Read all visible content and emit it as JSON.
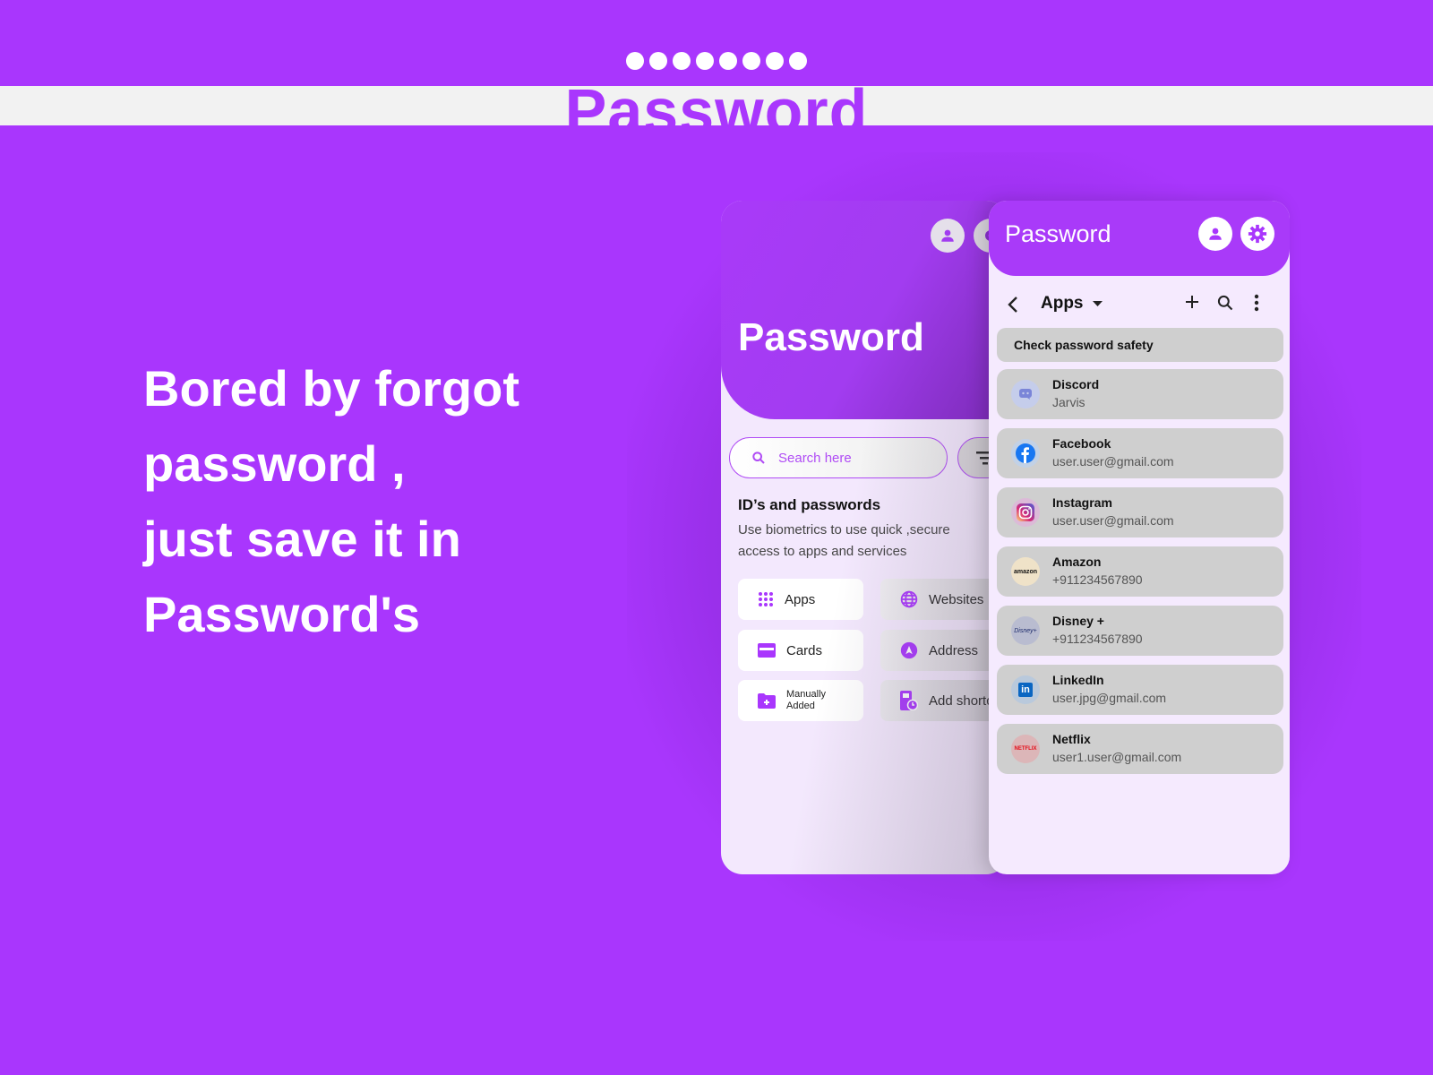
{
  "banner": {
    "dot_count": 8,
    "title": "Password"
  },
  "tagline": {
    "lines": [
      "Bored by forgot",
      "password ,",
      "just save it in",
      "Password's"
    ]
  },
  "back_screen": {
    "title": "Password",
    "search_placeholder": "Search here",
    "section_title": "ID’s and passwords",
    "section_desc": "Use biometrics to use quick ,secure access to apps and services",
    "tiles": [
      {
        "label": "Apps",
        "icon": "apps-grid-icon"
      },
      {
        "label": "Websites",
        "icon": "globe-icon"
      },
      {
        "label": "Cards",
        "icon": "credit-card-icon"
      },
      {
        "label": "Address",
        "icon": "navigation-icon"
      },
      {
        "label": "Manually Added",
        "icon": "folder-add-icon"
      },
      {
        "label": "Add shortcut",
        "icon": "shortcut-icon"
      }
    ]
  },
  "front_screen": {
    "title": "Password",
    "category": "Apps",
    "check_safety": "Check password safety",
    "items": [
      {
        "name": "Discord",
        "sub": "Jarvis",
        "logo_text": "",
        "logo_bg": "#c5cdeb",
        "logo_color": "#7a85d8"
      },
      {
        "name": "Facebook",
        "sub": "user.user@gmail.com",
        "logo_text": "f",
        "logo_bg": "#c2d1e6",
        "logo_color": "#1877f2"
      },
      {
        "name": "Instagram",
        "sub": "user.user@gmail.com",
        "logo_text": "",
        "logo_bg": "#dcbad8",
        "logo_color": "#d6249f"
      },
      {
        "name": "Amazon",
        "sub": "+911234567890",
        "logo_text": "amazon",
        "logo_bg": "#efe2c8",
        "logo_color": "#111111"
      },
      {
        "name": "Disney +",
        "sub": "+911234567890",
        "logo_text": "Disney+",
        "logo_bg": "#b9bcd0",
        "logo_color": "#1c2a6b"
      },
      {
        "name": "LinkedIn",
        "sub": "user.jpg@gmail.com",
        "logo_text": "in",
        "logo_bg": "#b9c9dc",
        "logo_color": "#0a66c2"
      },
      {
        "name": "Netflix",
        "sub": "user1.user@gmail.com",
        "logo_text": "NETFLIX",
        "logo_bg": "#dcb6b8",
        "logo_color": "#e50914"
      }
    ]
  },
  "colors": {
    "brand": "#a936fd",
    "banner_bg": "#f2f2f2",
    "card_gray": "#cfcfcf",
    "screen_bg": "#f5eafe"
  }
}
